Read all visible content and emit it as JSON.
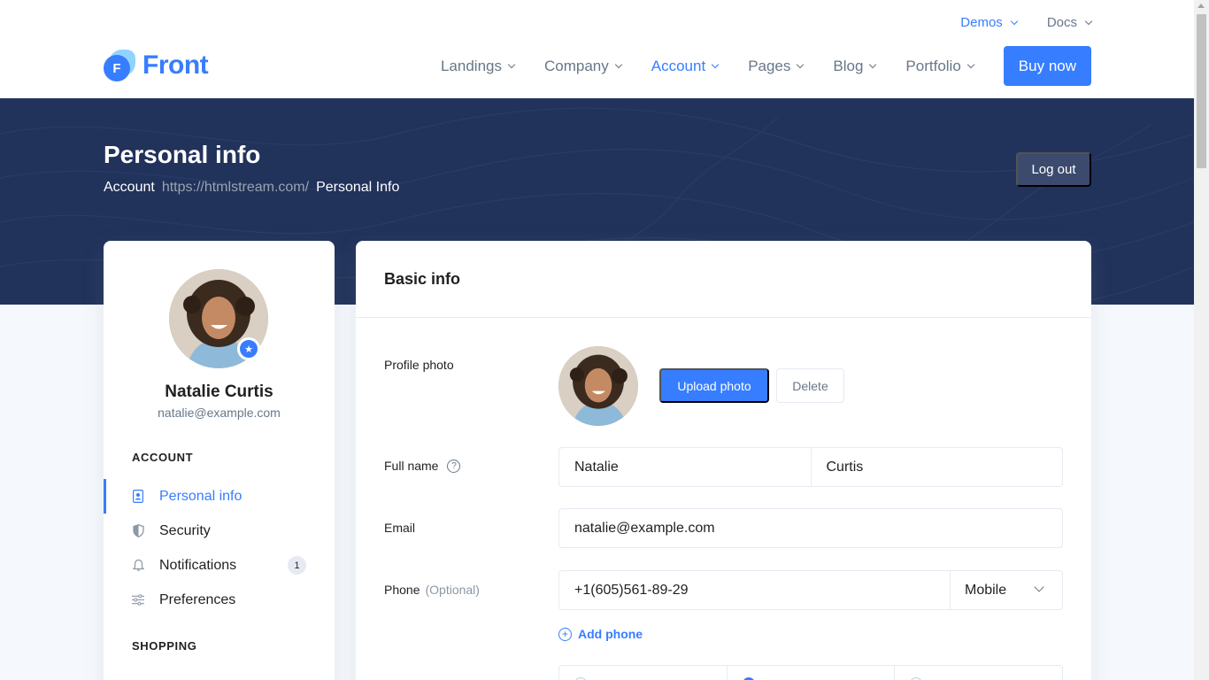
{
  "topbar": {
    "demos": "Demos",
    "docs": "Docs"
  },
  "brand": {
    "logo_letter": "F",
    "name": "Front",
    "accent": "#377dff"
  },
  "nav": {
    "items": [
      {
        "label": "Landings"
      },
      {
        "label": "Company"
      },
      {
        "label": "Account"
      },
      {
        "label": "Pages"
      },
      {
        "label": "Blog"
      },
      {
        "label": "Portfolio"
      }
    ],
    "active": "Account",
    "buy_label": "Buy now"
  },
  "hero": {
    "title": "Personal info",
    "breadcrumb": [
      "Account",
      "https://htmlstream.com/",
      "Personal Info"
    ],
    "logout_label": "Log out",
    "background": "#21325b"
  },
  "profile": {
    "name": "Natalie Curtis",
    "email": "natalie@example.com",
    "badge_icon": "star-icon"
  },
  "sidebar": {
    "account_heading": "ACCOUNT",
    "items": [
      {
        "label": "Personal info",
        "icon": "id-card-icon"
      },
      {
        "label": "Security",
        "icon": "shield-icon"
      },
      {
        "label": "Notifications",
        "icon": "bell-icon",
        "badge": "1"
      },
      {
        "label": "Preferences",
        "icon": "sliders-icon"
      }
    ],
    "shopping_heading": "SHOPPING"
  },
  "basic_info": {
    "title": "Basic info",
    "profile_photo_label": "Profile photo",
    "upload_label": "Upload photo",
    "delete_label": "Delete",
    "full_name_label": "Full name",
    "first_name": "Natalie",
    "last_name": "Curtis",
    "email_label": "Email",
    "email_value": "natalie@example.com",
    "phone_label": "Phone",
    "phone_optional": "(Optional)",
    "phone_value": "+1(605)561-89-29",
    "phone_type": "Mobile",
    "add_phone_label": "Add phone"
  }
}
